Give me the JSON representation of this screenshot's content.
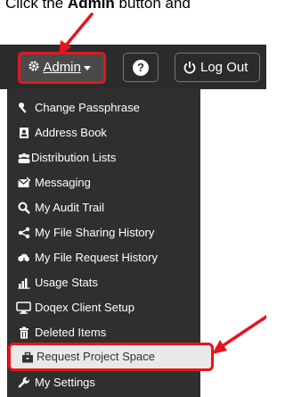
{
  "caption": {
    "prefix": "Click the ",
    "bold": "Admin",
    "suffix": " button and"
  },
  "navbar": {
    "admin_label": "Admin",
    "logout_label": "Log Out",
    "help_symbol": "?"
  },
  "menu": {
    "items": [
      {
        "label": "Change Passphrase",
        "icon": "key-icon"
      },
      {
        "label": "Address Book",
        "icon": "address-book-icon"
      },
      {
        "label": "Distribution Lists",
        "icon": "users-icon"
      },
      {
        "label": "Messaging",
        "icon": "envelope-icon"
      },
      {
        "label": "My Audit Trail",
        "icon": "search-icon"
      },
      {
        "label": "My File Sharing History",
        "icon": "share-icon"
      },
      {
        "label": "My File Request History",
        "icon": "cloud-icon"
      },
      {
        "label": "Usage Stats",
        "icon": "bar-chart-icon"
      },
      {
        "label": "Doqex Client Setup",
        "icon": "desktop-icon"
      },
      {
        "label": "Deleted Items",
        "icon": "trash-icon"
      },
      {
        "label": "Request Project Space",
        "icon": "briefcase-icon"
      },
      {
        "label": "My Settings",
        "icon": "wrench-icon"
      }
    ]
  },
  "colors": {
    "annotation_red": "#e8141c",
    "navbar_bg": "#2b2b2b",
    "menu_bg": "#2f2f2f"
  }
}
